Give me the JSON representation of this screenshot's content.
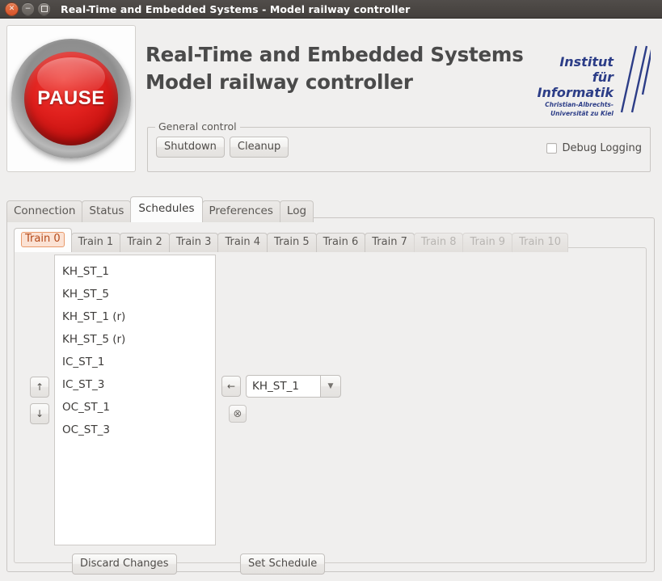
{
  "window": {
    "title": "Real-Time and Embedded Systems - Model railway controller",
    "controls": {
      "close": "close-icon",
      "minimize": "minimize-icon",
      "maximize": "maximize-icon"
    }
  },
  "header": {
    "title_line1": "Real-Time and Embedded Systems",
    "title_line2": "Model railway controller",
    "pause_button_label": "PAUSE",
    "institute_logo": {
      "line1": "Institut",
      "line2": "für Informatik",
      "line3": "Christian-Albrechts-Universität zu Kiel",
      "color": "#2c3d87"
    }
  },
  "general_control": {
    "legend": "General control",
    "shutdown_label": "Shutdown",
    "cleanup_label": "Cleanup",
    "debug_logging_label": "Debug Logging",
    "debug_logging_checked": false
  },
  "main_tabs": {
    "selected": "Schedules",
    "items": [
      {
        "label": "Connection"
      },
      {
        "label": "Status"
      },
      {
        "label": "Schedules"
      },
      {
        "label": "Preferences"
      },
      {
        "label": "Log"
      }
    ]
  },
  "train_tabs": {
    "selected": "Train 0",
    "items": [
      {
        "label": "Train 0",
        "state": "selected"
      },
      {
        "label": "Train 1",
        "state": "enabled"
      },
      {
        "label": "Train 2",
        "state": "enabled"
      },
      {
        "label": "Train 3",
        "state": "enabled"
      },
      {
        "label": "Train 4",
        "state": "enabled"
      },
      {
        "label": "Train 5",
        "state": "enabled"
      },
      {
        "label": "Train 6",
        "state": "enabled"
      },
      {
        "label": "Train 7",
        "state": "enabled"
      },
      {
        "label": "Train 8",
        "state": "disabled"
      },
      {
        "label": "Train 9",
        "state": "disabled"
      },
      {
        "label": "Train 10",
        "state": "disabled"
      }
    ],
    "selected_accent": "#e89a6b"
  },
  "schedule": {
    "list_items": [
      {
        "label": "KH_ST_1"
      },
      {
        "label": "KH_ST_5"
      },
      {
        "label": "KH_ST_1 (r)"
      },
      {
        "label": "KH_ST_5 (r)"
      },
      {
        "label": "IC_ST_1"
      },
      {
        "label": "IC_ST_3"
      },
      {
        "label": "OC_ST_1"
      },
      {
        "label": "OC_ST_3"
      }
    ],
    "move_up_icon": "↑",
    "move_down_icon": "↓",
    "add_back_icon": "←",
    "clear_icon": "⊗",
    "station_select_value": "KH_ST_1",
    "station_select_arrow": "▼",
    "discard_label": "Discard Changes",
    "set_schedule_label": "Set Schedule"
  }
}
